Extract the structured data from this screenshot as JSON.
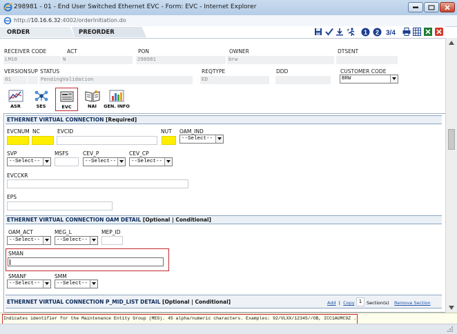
{
  "window": {
    "title": "298981 - 01 - End User Switched Ethernet EVC - Form: EVC - Internet Explorer",
    "url_host": "10.16.6.32",
    "url_prefix": "http://",
    "url_suffix": ":4002/orderInitiation.do"
  },
  "tabs": {
    "order": "ORDER",
    "preorder": "PREORDER"
  },
  "toolbar": {
    "icons": [
      "save-icon",
      "validate-check-icon",
      "download-icon",
      "run-icon",
      "page-1-icon",
      "page-2-icon",
      "page-3-4-icon",
      "print-icon",
      "grid-icon",
      "excel-icon",
      "close-icon"
    ],
    "page1": "1",
    "page2": "2",
    "page34": "3/4"
  },
  "header": {
    "receiver_code_label": "RECEIVER CODE",
    "receiver_code": "LM10",
    "act_label": "ACT",
    "act": "N",
    "pon_label": "PON",
    "pon": "298981",
    "owner_label": "OWNER",
    "owner": "brw",
    "dtsent_label": "DTSENT",
    "dtsent": "",
    "version_label": "VERSION",
    "version": "01",
    "sup_label": "SUP",
    "sup": "",
    "status_label": "STATUS",
    "status": "PendingValidation",
    "reqtype_label": "REQTYPE",
    "reqtype": "ED",
    "ddd_label": "DDD",
    "ddd": "",
    "customer_code_label": "CUSTOMER CODE",
    "customer_code": "BRW"
  },
  "form_buttons": [
    {
      "label": "ASR",
      "icon": "asr-chart-icon"
    },
    {
      "label": "SES",
      "icon": "ses-network-icon"
    },
    {
      "label": "EVC",
      "icon": "evc-form-icon"
    },
    {
      "label": "NAI",
      "icon": "nai-book-icon"
    },
    {
      "label": "GEN. INFO",
      "icon": "gen-info-chart-icon"
    }
  ],
  "evc_section": {
    "title": "ETHERNET VIRTUAL CONNECTION",
    "flag": "[Required]",
    "evcnum_label": "EVCNUM",
    "nc_label": "NC",
    "evcid_label": "EVCID",
    "nut_label": "NUT",
    "oam_ind_label": "OAM_IND",
    "oam_ind_value": "--Select--",
    "svp_label": "SVP",
    "svp_value": "--Select--",
    "msfs_label": "MSFS",
    "cev_p_label": "CEV_P",
    "cev_p_value": "--Select--",
    "cev_cp_label": "CEV_CP",
    "cev_cp_value": "--Select--",
    "evcckr_label": "EVCCKR",
    "eps_label": "EPS"
  },
  "oam_section": {
    "title": "ETHERNET VIRTUAL CONNECTION OAM DETAIL",
    "flag": "[Optional | Conditional]",
    "oam_act_label": "OAM_ACT",
    "oam_act_value": "--Select--",
    "meg_l_label": "MEG_L",
    "meg_l_value": "--Select--",
    "mep_id_label": "MEP_ID",
    "sman_label": "SMAN",
    "smanf_label": "SMANF",
    "smanf_value": "--Select--",
    "smm_label": "SMM",
    "smm_value": "--Select--"
  },
  "pmid_section": {
    "title": "ETHERNET VIRTUAL CONNECTION P_MID_LIST DETAIL",
    "flag": "[Optional | Conditional]",
    "add_link": "Add",
    "copy_link": "Copy",
    "section_count": "1",
    "sections_label": "Section(s)",
    "remove_link": "Remove Section"
  },
  "status_message": "Indicates identifier for the Maintenance Entity Group (MEG). 45 alpha/numeric characters. Examples: 92/VLXX/12345//OB, ICC1AUMC9Z .",
  "colors": {
    "required_field": "#ffee00",
    "highlight_border": "#c2272d",
    "section_title": "#0c2a5a"
  }
}
